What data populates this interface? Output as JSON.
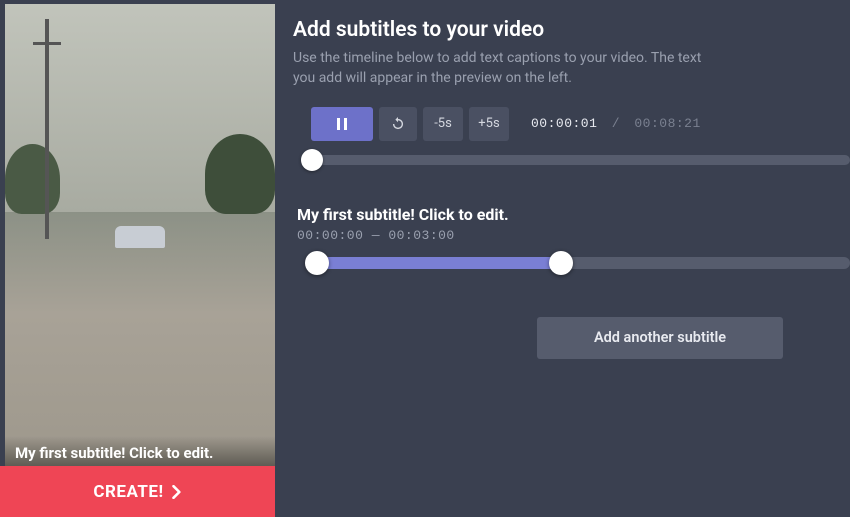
{
  "header": {
    "title": "Add subtitles to your video",
    "description": "Use the timeline below to add text captions to your video. The text you add will appear in the preview on the left."
  },
  "controls": {
    "back5": "-5s",
    "fwd5": "+5s"
  },
  "time": {
    "current": "00:00:01",
    "sep": "/",
    "total": "00:08:21"
  },
  "subtitle": {
    "text": "My first subtitle! Click to edit.",
    "range": "00:00:00 — 00:03:00",
    "overlay": "My first subtitle! Click to edit."
  },
  "buttons": {
    "add": "Add another subtitle",
    "create": "CREATE!"
  }
}
